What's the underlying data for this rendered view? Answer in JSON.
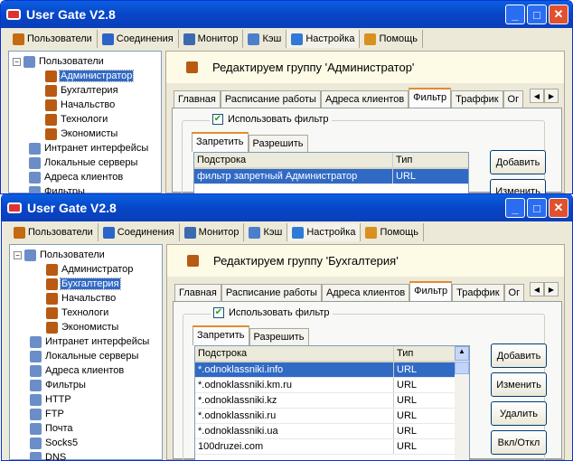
{
  "windows": [
    {
      "title": "User Gate V2.8",
      "menu": [
        {
          "label": "Пользователи",
          "icon": "users-icon",
          "color": "#c56a10"
        },
        {
          "label": "Соединения",
          "icon": "connections-icon",
          "color": "#2b64c8"
        },
        {
          "label": "Монитор",
          "icon": "monitor-icon",
          "color": "#3b6ab0"
        },
        {
          "label": "Кэш",
          "icon": "cache-icon",
          "color": "#4b7fcc"
        },
        {
          "label": "Настройка",
          "icon": "settings-icon",
          "color": "#2f7ad8",
          "active": true
        },
        {
          "label": "Помощь",
          "icon": "help-icon",
          "color": "#d89020"
        }
      ],
      "tree": [
        {
          "label": "Пользователи",
          "level": 0,
          "expand": "−",
          "icon": "users-icon"
        },
        {
          "label": "Администратор",
          "level": 1,
          "icon": "group-icon",
          "selected": true
        },
        {
          "label": "Бухгалтерия",
          "level": 1,
          "icon": "group-icon"
        },
        {
          "label": "Начальство",
          "level": 1,
          "icon": "group-icon"
        },
        {
          "label": "Технологи",
          "level": 1,
          "icon": "group-icon"
        },
        {
          "label": "Экономисты",
          "level": 1,
          "icon": "group-icon"
        },
        {
          "label": "Интранет интерфейсы",
          "level": 0,
          "icon": "interface-icon"
        },
        {
          "label": "Локальные серверы",
          "level": 0,
          "icon": "server-icon"
        },
        {
          "label": "Адреса клиентов",
          "level": 0,
          "icon": "clients-icon"
        },
        {
          "label": "Фильтры",
          "level": 0,
          "icon": "filter-icon"
        }
      ],
      "header": "Редактируем группу 'Администратор'",
      "tabs": [
        "Главная",
        "Расписание работы",
        "Адреса клиентов",
        "Фильтр",
        "Траффик",
        "Ог"
      ],
      "active_tab": 3,
      "use_filter_label": "Использовать фильтр",
      "subtabs": [
        "Запретить",
        "Разрешить"
      ],
      "columns": [
        "Подстрока",
        "Тип"
      ],
      "rows": [
        [
          "фильтр запретный Администратор",
          "URL"
        ]
      ],
      "scrollbar": false,
      "buttons": [
        "Добавить",
        "Изменить"
      ]
    },
    {
      "title": "User Gate V2.8",
      "menu": [
        {
          "label": "Пользователи",
          "icon": "users-icon",
          "color": "#c56a10"
        },
        {
          "label": "Соединения",
          "icon": "connections-icon",
          "color": "#2b64c8"
        },
        {
          "label": "Монитор",
          "icon": "monitor-icon",
          "color": "#3b6ab0"
        },
        {
          "label": "Кэш",
          "icon": "cache-icon",
          "color": "#4b7fcc"
        },
        {
          "label": "Настройка",
          "icon": "settings-icon",
          "color": "#2f7ad8",
          "active": true
        },
        {
          "label": "Помощь",
          "icon": "help-icon",
          "color": "#d89020"
        }
      ],
      "tree": [
        {
          "label": "Пользователи",
          "level": 0,
          "expand": "−",
          "icon": "users-icon"
        },
        {
          "label": "Администратор",
          "level": 1,
          "icon": "group-icon"
        },
        {
          "label": "Бухгалтерия",
          "level": 1,
          "icon": "group-icon",
          "selected": true
        },
        {
          "label": "Начальство",
          "level": 1,
          "icon": "group-icon"
        },
        {
          "label": "Технологи",
          "level": 1,
          "icon": "group-icon"
        },
        {
          "label": "Экономисты",
          "level": 1,
          "icon": "group-icon"
        },
        {
          "label": "Интранет интерфейсы",
          "level": 0,
          "icon": "interface-icon"
        },
        {
          "label": "Локальные серверы",
          "level": 0,
          "icon": "server-icon"
        },
        {
          "label": "Адреса клиентов",
          "level": 0,
          "icon": "clients-icon"
        },
        {
          "label": "Фильтры",
          "level": 0,
          "icon": "filter-icon"
        },
        {
          "label": "HTTP",
          "level": 0,
          "icon": "globe-icon"
        },
        {
          "label": "FTP",
          "level": 0,
          "icon": "computers-icon"
        },
        {
          "label": "Почта",
          "level": 0,
          "icon": "mail-icon"
        },
        {
          "label": "Socks5",
          "level": 0,
          "icon": "socks-icon"
        },
        {
          "label": "DNS",
          "level": 0,
          "icon": "dns-icon"
        }
      ],
      "header": "Редактируем группу 'Бухгалтерия'",
      "tabs": [
        "Главная",
        "Расписание работы",
        "Адреса клиентов",
        "Фильтр",
        "Траффик",
        "Ог"
      ],
      "active_tab": 3,
      "use_filter_label": "Использовать фильтр",
      "subtabs": [
        "Запретить",
        "Разрешить"
      ],
      "columns": [
        "Подстрока",
        "Тип"
      ],
      "rows": [
        [
          "*.odnoklassniki.info",
          "URL"
        ],
        [
          "*.odnoklassniki.km.ru",
          "URL"
        ],
        [
          "*.odnoklassniki.kz",
          "URL"
        ],
        [
          "*.odnoklassniki.ru",
          "URL"
        ],
        [
          "*.odnoklassniki.ua",
          "URL"
        ],
        [
          "100druzei.com",
          "URL"
        ]
      ],
      "scrollbar": true,
      "buttons": [
        "Добавить",
        "Изменить",
        "Удалить",
        "Вкл/Откл"
      ]
    }
  ]
}
